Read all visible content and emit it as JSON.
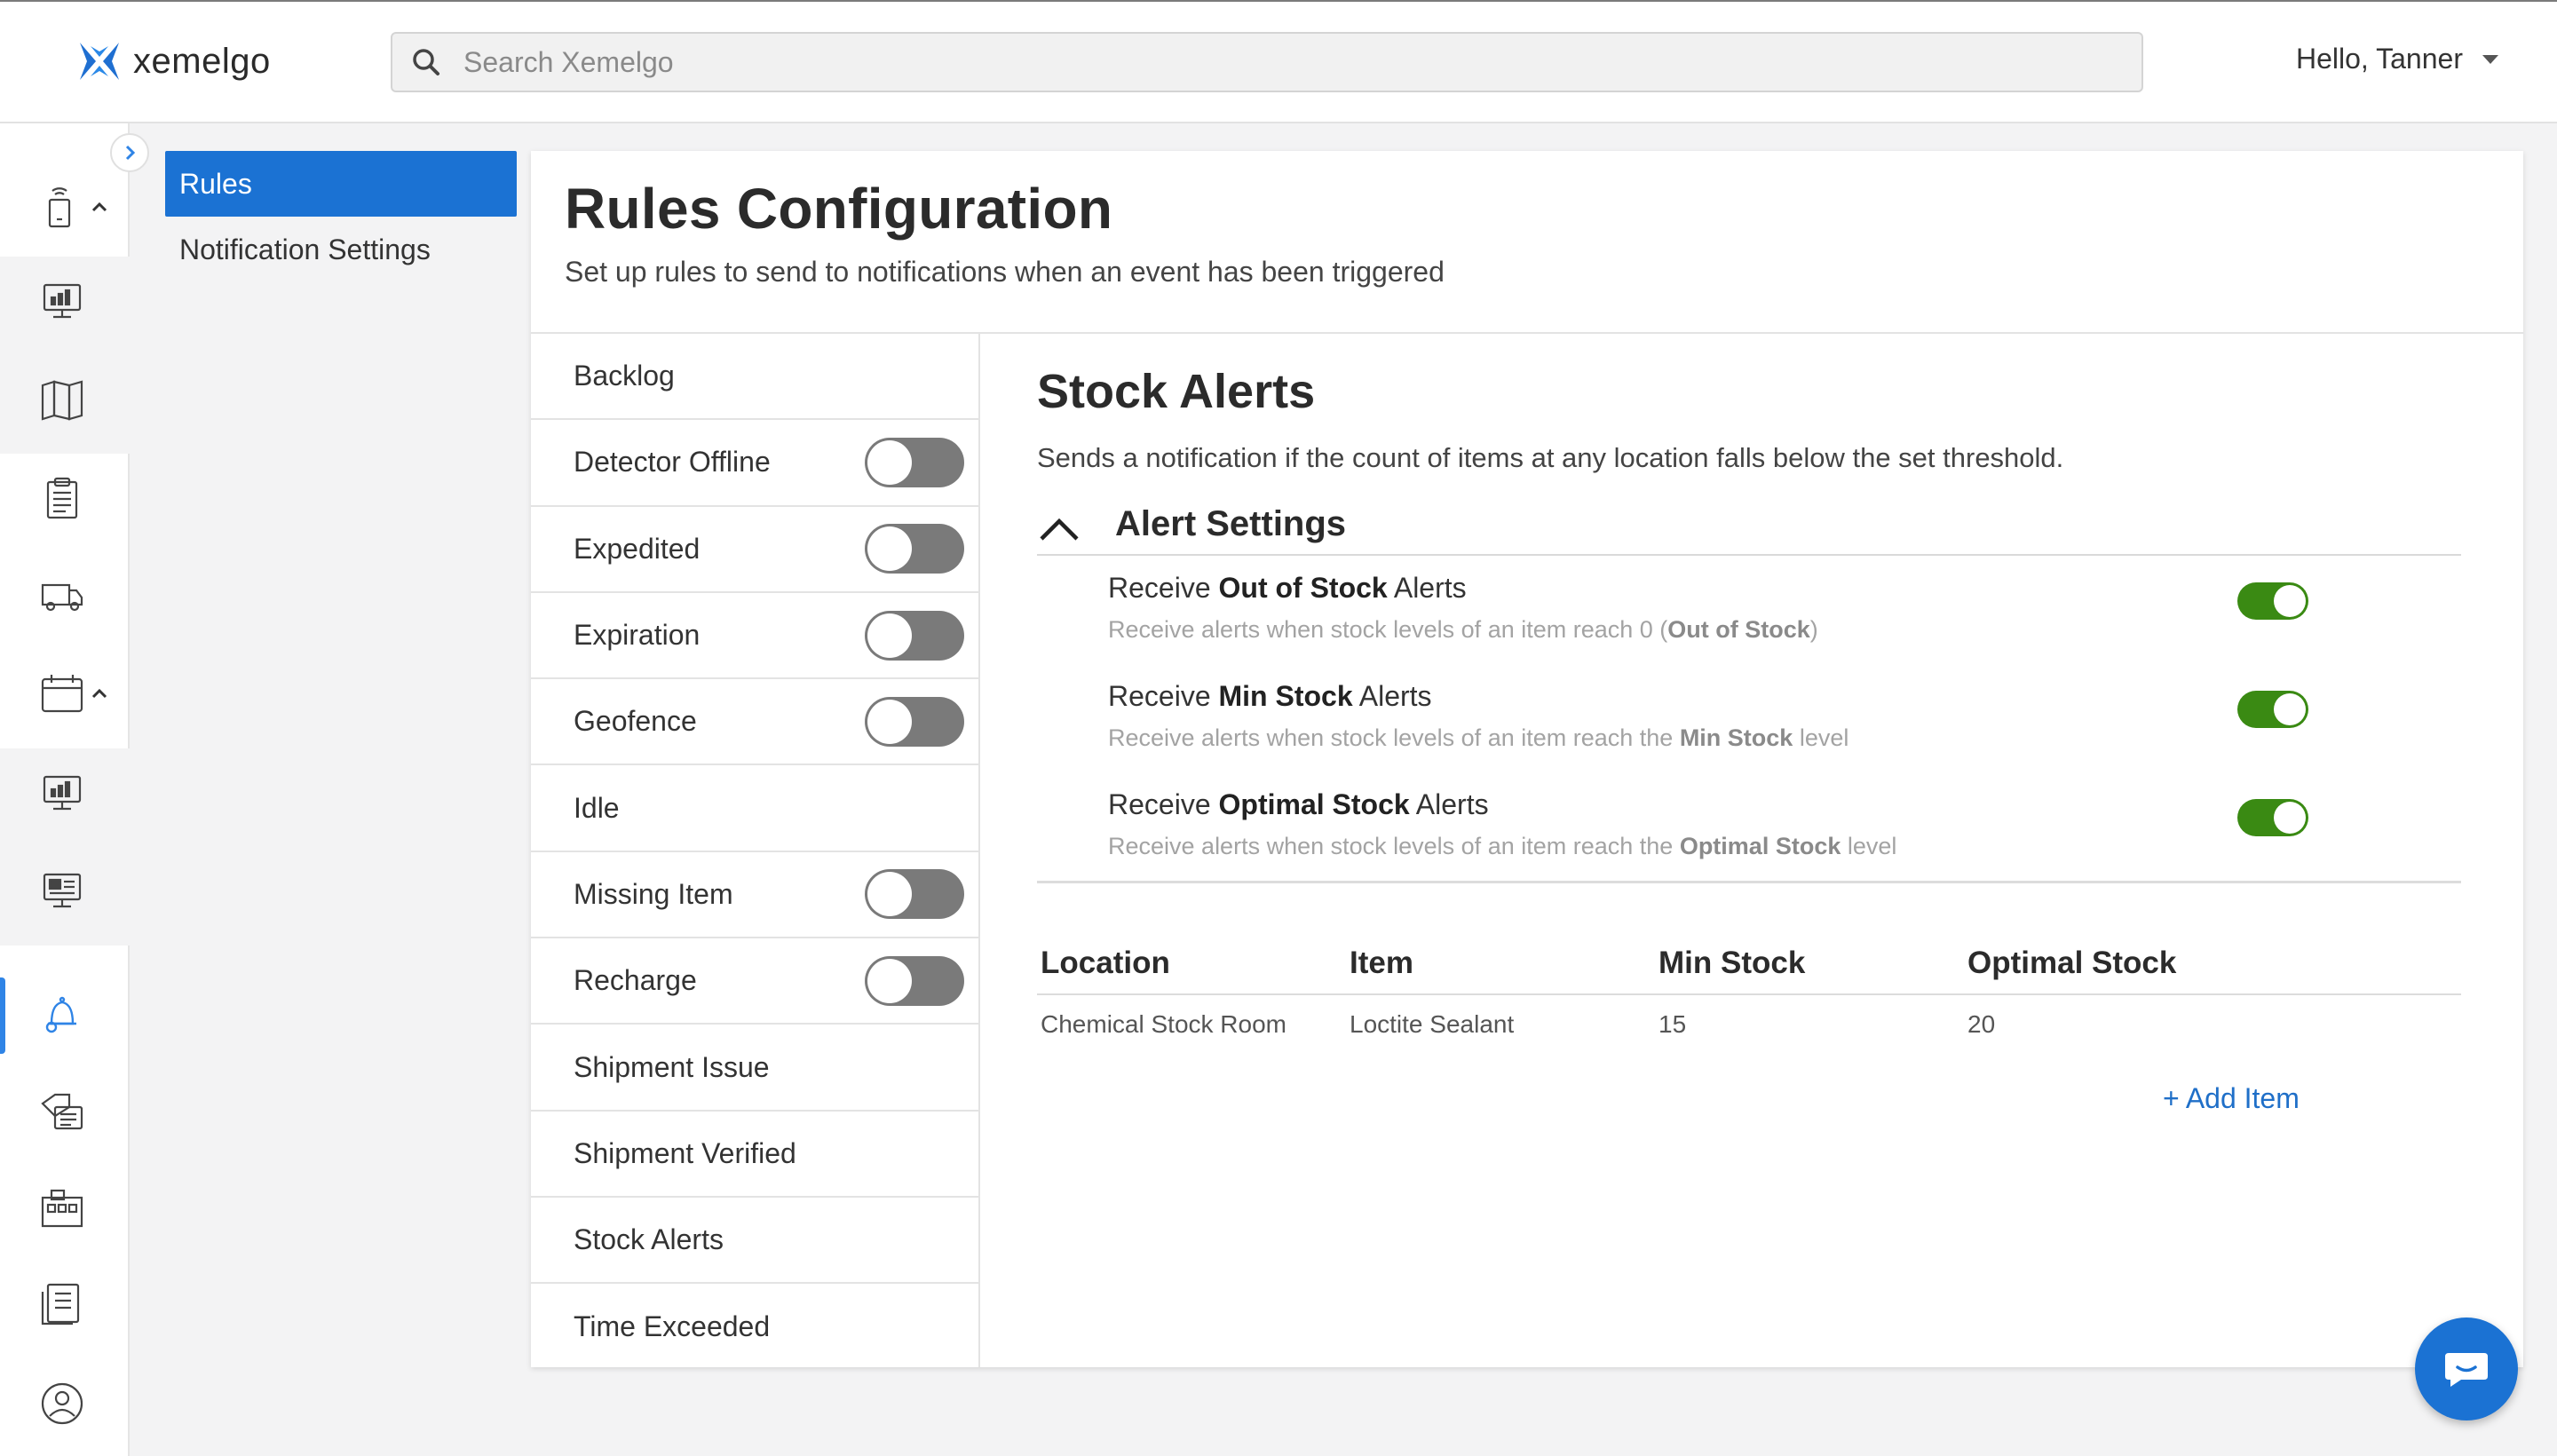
{
  "header": {
    "brand": "xemelgo",
    "search_placeholder": "Search Xemelgo",
    "greeting": "Hello, Tanner"
  },
  "subnav": {
    "items": [
      {
        "label": "Rules",
        "active": true
      },
      {
        "label": "Notification Settings",
        "active": false
      }
    ]
  },
  "page": {
    "title": "Rules Configuration",
    "subtitle": "Set up rules to send to notifications when an event has been triggered"
  },
  "rules": [
    {
      "label": "Backlog",
      "toggle": null
    },
    {
      "label": "Detector Offline",
      "toggle": "off"
    },
    {
      "label": "Expedited",
      "toggle": "off"
    },
    {
      "label": "Expiration",
      "toggle": "off"
    },
    {
      "label": "Geofence",
      "toggle": "off"
    },
    {
      "label": "Idle",
      "toggle": null
    },
    {
      "label": "Missing Item",
      "toggle": "off"
    },
    {
      "label": "Recharge",
      "toggle": "off"
    },
    {
      "label": "Shipment Issue",
      "toggle": null
    },
    {
      "label": "Shipment Verified",
      "toggle": null
    },
    {
      "label": "Stock Alerts",
      "toggle": null
    },
    {
      "label": "Time Exceeded",
      "toggle": null
    }
  ],
  "detail": {
    "title": "Stock Alerts",
    "description": "Sends a notification if the count of items at any location falls below the set threshold.",
    "settings_header": "Alert Settings",
    "alerts": [
      {
        "prefix": "Receive ",
        "strong": "Out of Stock",
        "suffix": " Alerts",
        "note_prefix": "Receive alerts when stock levels of an item reach 0 (",
        "note_strong": "Out of Stock",
        "note_suffix": ")",
        "enabled": true
      },
      {
        "prefix": "Receive ",
        "strong": "Min Stock",
        "suffix": " Alerts",
        "note_prefix": "Receive alerts when stock levels of an item reach the ",
        "note_strong": "Min Stock",
        "note_suffix": " level",
        "enabled": true
      },
      {
        "prefix": "Receive ",
        "strong": "Optimal Stock",
        "suffix": " Alerts",
        "note_prefix": "Receive alerts when stock levels of an item reach the ",
        "note_strong": "Optimal Stock",
        "note_suffix": " level",
        "enabled": true
      }
    ],
    "table": {
      "columns": [
        "Location",
        "Item",
        "Min Stock",
        "Optimal Stock"
      ],
      "rows": [
        [
          "Chemical Stock Room",
          "Loctite Sealant",
          "15",
          "20"
        ]
      ]
    },
    "add_item_label": "+ Add Item"
  },
  "colors": {
    "primary": "#1b72d3",
    "toggle_on": "#3a8a13",
    "toggle_off": "#7a7a7a",
    "rail_active": "#2f84e6"
  }
}
